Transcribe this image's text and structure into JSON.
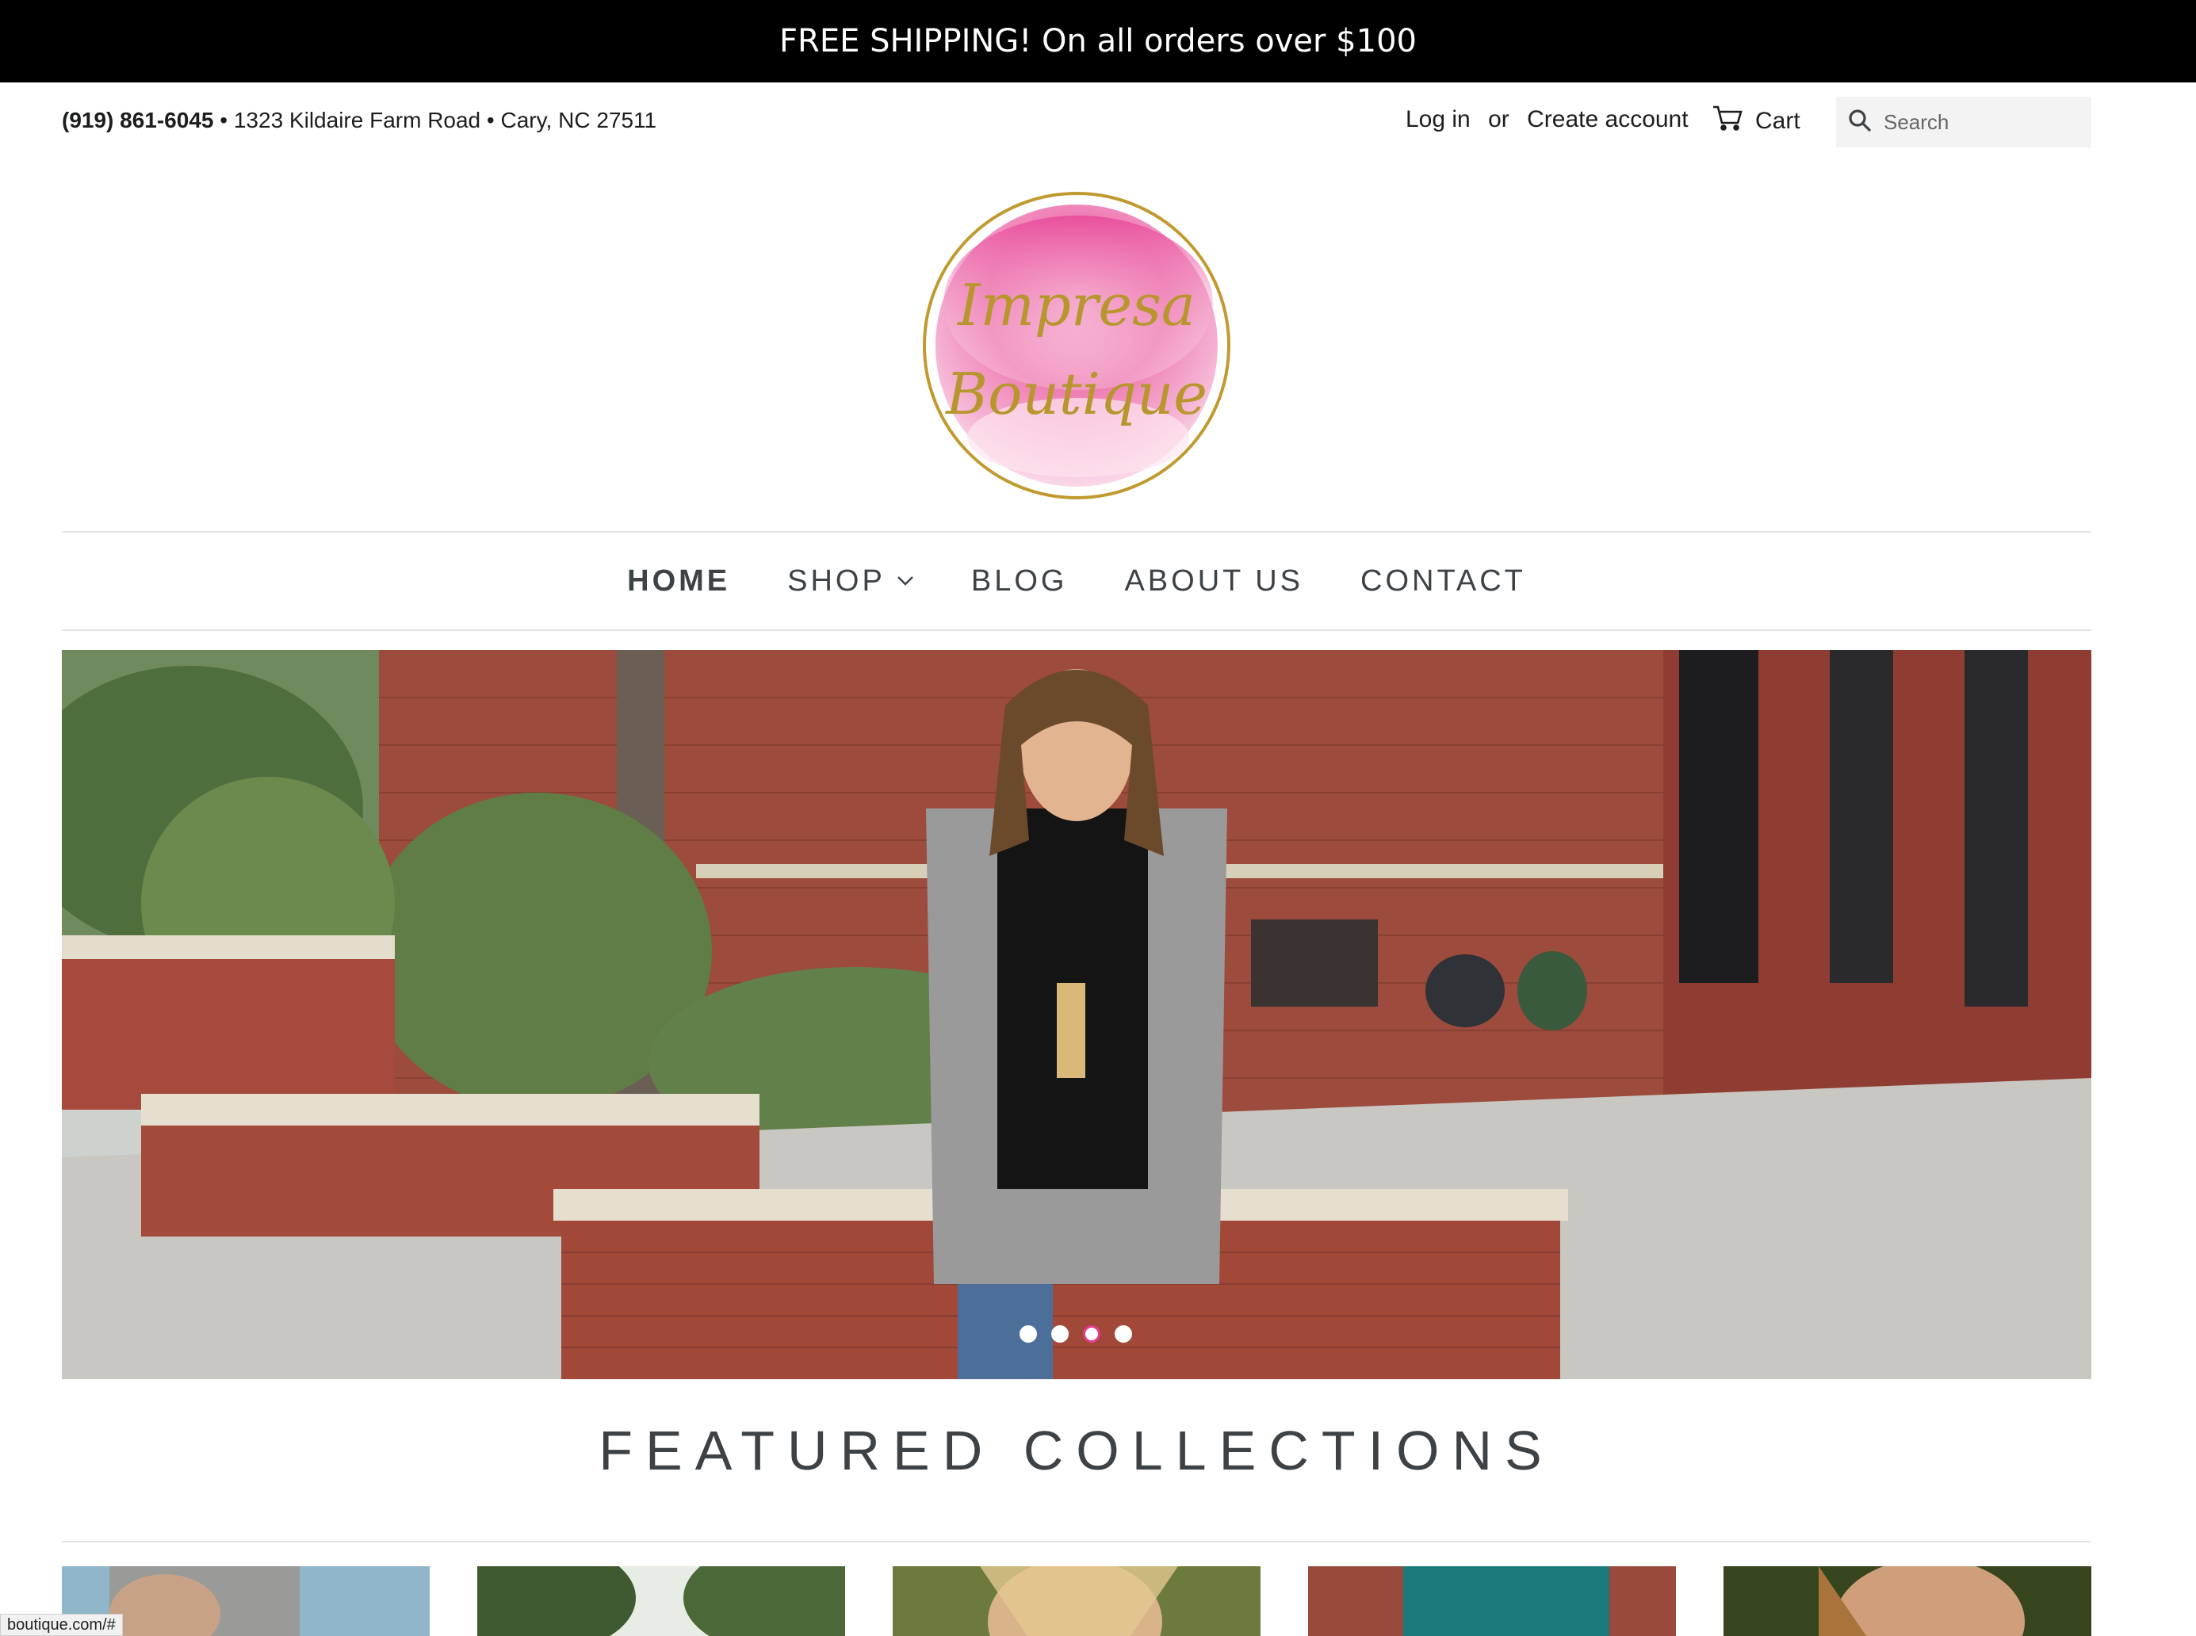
{
  "announcement": "FREE SHIPPING! On all orders over $100",
  "header": {
    "phone": "(919) 861-6045",
    "sep1": " • ",
    "address": "1323 Kildaire Farm Road",
    "sep2": " • ",
    "city": "Cary, NC 27511",
    "login": "Log in",
    "or": "or",
    "create_account": "Create account",
    "cart": "Cart",
    "search_placeholder": "Search"
  },
  "logo": {
    "line1": "Impresa",
    "line2": "Boutique"
  },
  "nav": {
    "items": [
      {
        "label": "HOME",
        "active": true
      },
      {
        "label": "SHOP",
        "has_dropdown": true
      },
      {
        "label": "BLOG"
      },
      {
        "label": "ABOUT US"
      },
      {
        "label": "CONTACT"
      }
    ]
  },
  "slideshow": {
    "slide_count": 4,
    "active_index": 2
  },
  "featured": {
    "title": "FEATURED COLLECTIONS"
  },
  "status_bar": "boutique.com/#",
  "colors": {
    "announcement_bg": "#000000",
    "accent_pink": "#e33b8f",
    "logo_gold": "#b8962e",
    "nav_text": "#3d4246"
  }
}
